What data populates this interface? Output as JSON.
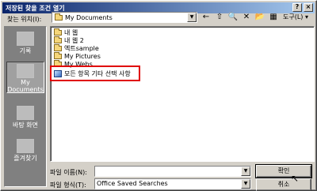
{
  "window": {
    "title": "저장된 찾을 조건 열기",
    "help_label": "?",
    "close_label": "×"
  },
  "look_in": {
    "label": "찾는 위치(I):",
    "value": "My Documents"
  },
  "toolbar": {
    "back": "←",
    "up": "⇧",
    "search": "🔍",
    "delete": "✕",
    "new_folder": "📂",
    "views": "▦",
    "tools_label": "도구(L) ▾"
  },
  "places": [
    {
      "label": "기록"
    },
    {
      "label": "My Documents"
    },
    {
      "label": "바탕 화면"
    },
    {
      "label": "즐겨찾기"
    }
  ],
  "files": [
    {
      "name": "내 웹",
      "type": "folder"
    },
    {
      "name": "내 웹 2",
      "type": "folder"
    },
    {
      "name": "엑트sample",
      "type": "folder"
    },
    {
      "name": "My Pictures",
      "type": "folder"
    },
    {
      "name": "My Webs",
      "type": "folder"
    },
    {
      "name": "모든 항목 기타 선택 사항",
      "type": "search"
    }
  ],
  "file_name": {
    "label": "파일 이름(N):",
    "value": ""
  },
  "file_type": {
    "label": "파일 형식(T):",
    "value": "Office Saved Searches"
  },
  "buttons": {
    "open": "확인",
    "cancel": "취소"
  }
}
